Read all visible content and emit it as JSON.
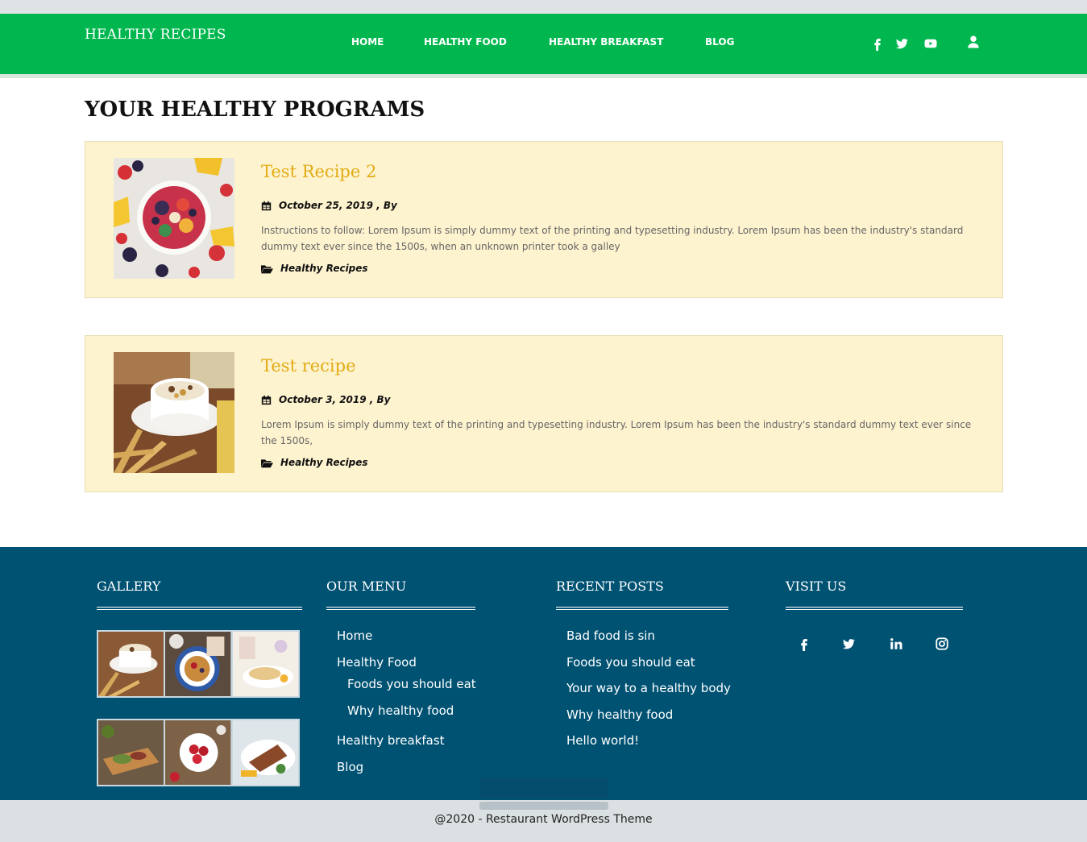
{
  "header": {
    "brand": "HEALTHY RECIPES",
    "nav": [
      {
        "label": "HOME"
      },
      {
        "label": "HEALTHY FOOD"
      },
      {
        "label": "HEALTHY BREAKFAST"
      },
      {
        "label": "BLOG"
      }
    ],
    "icons": [
      "facebook-icon",
      "twitter-icon",
      "youtube-icon",
      "user-icon"
    ]
  },
  "main": {
    "title": "YOUR HEALTHY PROGRAMS",
    "posts": [
      {
        "title": "Test Recipe 2",
        "date": "October 25, 2019 , By",
        "description": "Instructions to follow: Lorem Ipsum is simply dummy text of the printing and typesetting industry. Lorem Ipsum has been the industry's standard dummy text ever since the 1500s, when an unknown printer took a galley",
        "category": "Healthy Recipes",
        "image": "fruit-bowl-image"
      },
      {
        "title": "Test recipe",
        "date": "October 3, 2019 , By",
        "description": "Lorem Ipsum is simply dummy text of the printing and typesetting industry. Lorem Ipsum has been the industry's standard dummy text ever since the 1500s,",
        "category": "Healthy Recipes",
        "image": "cereal-cup-image"
      }
    ]
  },
  "footer": {
    "gallery": {
      "heading": "GALLERY"
    },
    "menu": {
      "heading": "OUR MENU",
      "items": [
        {
          "label": "Home"
        },
        {
          "label": "Healthy Food"
        },
        {
          "label": "Foods you should eat"
        },
        {
          "label": "Why healthy food"
        },
        {
          "label": "Healthy breakfast"
        },
        {
          "label": "Blog"
        }
      ]
    },
    "recent": {
      "heading": "RECENT POSTS",
      "items": [
        {
          "label": "Bad food is sin"
        },
        {
          "label": "Foods you should eat"
        },
        {
          "label": "Your way to a healthy body"
        },
        {
          "label": "Why healthy food"
        },
        {
          "label": "Hello world!"
        }
      ]
    },
    "visit": {
      "heading": "VISIT US",
      "icons": [
        "facebook-icon",
        "twitter-icon",
        "linkedin-icon",
        "instagram-icon"
      ]
    },
    "copyright": "@2020 - Restaurant WordPress Theme"
  },
  "colors": {
    "nav_green": "#00b74f",
    "card_bg": "#fef3cf",
    "title_gold": "#e2ab14",
    "footer_blue": "#005273",
    "bottom_gray": "#dbe0e3"
  }
}
